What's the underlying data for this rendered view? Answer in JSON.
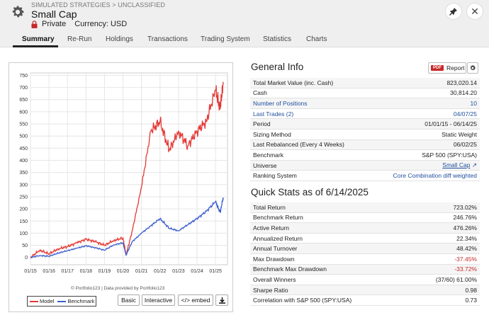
{
  "header": {
    "breadcrumb": "SIMULATED STRATEGIES > UNCLASSIFIED",
    "title": "Small Cap",
    "visibility": "Private",
    "currency": "Currency: USD",
    "pin_icon": "pin-icon",
    "close_icon": "close-icon"
  },
  "tabs": [
    {
      "label": "Summary",
      "active": true
    },
    {
      "label": "Re-Run"
    },
    {
      "label": "Holdings"
    },
    {
      "label": "Transactions"
    },
    {
      "label": "Trading System"
    },
    {
      "label": "Statistics"
    },
    {
      "label": "Charts"
    }
  ],
  "chart": {
    "credit": "© Portfolio123 | Data provided by Portfolio123",
    "legend": [
      "Model",
      "Benchmark"
    ],
    "buttons": {
      "basic": "Basic",
      "interactive": "Interactive",
      "embed": "</> embed"
    }
  },
  "chart_data": {
    "type": "line",
    "x": [
      "01/15",
      "07/15",
      "01/16",
      "07/16",
      "01/17",
      "07/17",
      "01/18",
      "07/18",
      "01/19",
      "07/19",
      "01/20",
      "03/20",
      "07/20",
      "01/21",
      "07/21",
      "01/22",
      "07/22",
      "01/23",
      "07/23",
      "01/24",
      "07/24",
      "01/25",
      "04/25",
      "06/25"
    ],
    "xticks": [
      "01/15",
      "01/16",
      "01/17",
      "01/18",
      "01/19",
      "01/20",
      "01/21",
      "01/22",
      "01/23",
      "01/24",
      "01/25"
    ],
    "yticks": [
      0,
      50,
      100,
      150,
      200,
      250,
      300,
      350,
      400,
      450,
      500,
      550,
      600,
      650,
      700,
      750
    ],
    "ylim": [
      -30,
      760
    ],
    "series": [
      {
        "name": "Model",
        "color": "#e53935",
        "values": [
          0,
          30,
          15,
          35,
          45,
          60,
          75,
          65,
          50,
          70,
          80,
          10,
          110,
          290,
          520,
          560,
          440,
          520,
          460,
          520,
          560,
          690,
          610,
          723
        ]
      },
      {
        "name": "Benchmark",
        "color": "#3a5fcd",
        "values": [
          0,
          8,
          5,
          18,
          28,
          38,
          48,
          40,
          30,
          52,
          60,
          10,
          65,
          100,
          130,
          160,
          120,
          110,
          135,
          160,
          190,
          230,
          185,
          247
        ]
      }
    ],
    "grid": true,
    "legend": "bottom-left"
  },
  "general_info": {
    "title": "General Info",
    "report_tag": "PDF",
    "report_label": "Report",
    "rows": [
      {
        "label": "Total Market Value (inc. Cash)",
        "value": "823,020.14"
      },
      {
        "label": "Cash",
        "value": "30,814.20"
      },
      {
        "label": "Number of Positions",
        "value": "10",
        "link": true
      },
      {
        "label": "Last Trades (2)",
        "value": "04/07/25",
        "link": true
      },
      {
        "label": "Period",
        "value": "01/01/15 - 06/14/25"
      },
      {
        "label": "Sizing Method",
        "value": "Static Weight"
      },
      {
        "label": "Last Rebalanced (Every 4 Weeks)",
        "value": "06/02/25"
      },
      {
        "label": "Benchmark",
        "value": "S&P 500 (SPY:USA)"
      },
      {
        "label": "Universe",
        "value": "Small Cap",
        "link": true
      },
      {
        "label": "Ranking System",
        "value": "Core Combination diff weighted",
        "link": true
      }
    ]
  },
  "quick_stats": {
    "title": "Quick Stats as of 6/14/2025",
    "rows": [
      {
        "label": "Total Return",
        "value": "723.02%"
      },
      {
        "label": "Benchmark Return",
        "value": "246.76%"
      },
      {
        "label": "Active Return",
        "value": "476.26%"
      },
      {
        "label": "Annualized Return",
        "value": "22.34%"
      },
      {
        "label": "Annual Turnover",
        "value": "48.42%"
      },
      {
        "label": "Max Drawdown",
        "value": "-37.45%",
        "red": true
      },
      {
        "label": "Benchmark Max Drawdown",
        "value": "-33.72%",
        "red": true
      },
      {
        "label": "Overall Winners",
        "value": "(37/60) 61.00%"
      },
      {
        "label": "Sharpe Ratio",
        "value": "0.98"
      },
      {
        "label": "Correlation with S&P 500 (SPY:USA)",
        "value": "0.73"
      }
    ]
  }
}
